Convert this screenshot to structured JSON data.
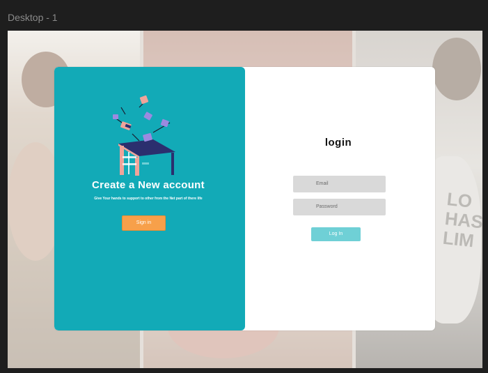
{
  "frame": {
    "label": "Desktop - 1"
  },
  "background": {
    "tshirt_text": "LO\nHAS\nLIM"
  },
  "left_panel": {
    "title": "Create a New account",
    "subtitle": "Give Your hands to support to other from the Net part of there life",
    "signin_label": "Sign in",
    "color": "#12aab7",
    "button_color": "#f7a04a"
  },
  "right_panel": {
    "title": "login",
    "email_placeholder": "Email",
    "password_placeholder": "Password",
    "login_label": "Log In",
    "button_color": "#6fd0d6"
  },
  "icons": [
    "donation-box-illustration"
  ]
}
